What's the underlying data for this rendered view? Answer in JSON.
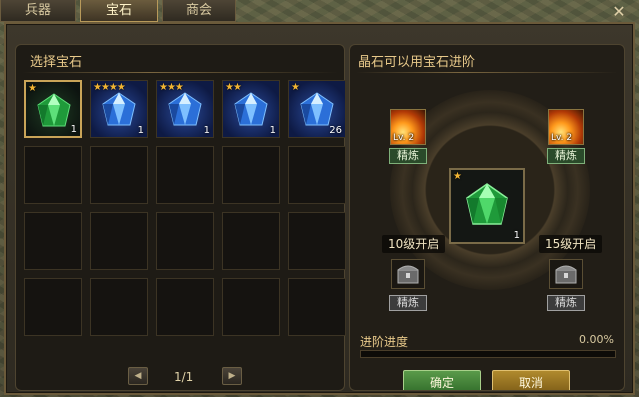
{
  "tabs": [
    {
      "label": "兵器",
      "active": false
    },
    {
      "label": "宝石",
      "active": true
    },
    {
      "label": "商会",
      "active": false
    }
  ],
  "close_icon": "close-icon",
  "left_panel": {
    "title": "选择宝石",
    "gems": [
      {
        "type": "green-gem",
        "stars": "★",
        "count": "1",
        "selected": true
      },
      {
        "type": "blue-gem",
        "stars": "★★★★",
        "count": "1",
        "selected": false
      },
      {
        "type": "blue-gem",
        "stars": "★★★",
        "count": "1",
        "selected": false
      },
      {
        "type": "blue-gem",
        "stars": "★★",
        "count": "1",
        "selected": false
      },
      {
        "type": "blue-gem",
        "stars": "★",
        "count": "26",
        "selected": false
      }
    ],
    "grid_rows": 4,
    "grid_cols": 5,
    "pager": {
      "text": "1/1",
      "prev_icon": "prev-arrow-icon",
      "next_icon": "next-arrow-icon"
    }
  },
  "right_panel": {
    "title": "晶石可以用宝石进阶",
    "center_gem": {
      "type": "green-gem",
      "stars": "★",
      "count": "1"
    },
    "left_skill": {
      "level": "Lv. 2",
      "refine_label": "精炼"
    },
    "right_skill": {
      "level": "Lv. 2",
      "refine_label": "精炼"
    },
    "left_unlock": {
      "label": "10级开启",
      "refine_label": "精炼",
      "icon": "locked-chest-icon"
    },
    "right_unlock": {
      "label": "15级开启",
      "refine_label": "精炼",
      "icon": "locked-chest-icon"
    },
    "progress": {
      "label": "进阶进度",
      "value_text": "0.00%",
      "fraction": 0
    },
    "ok_label": "确定",
    "cancel_label": "取消"
  },
  "colors": {
    "accent_gold": "#e8c98a",
    "green_button": "#2f6a28",
    "gold_button": "#7a5a16"
  }
}
